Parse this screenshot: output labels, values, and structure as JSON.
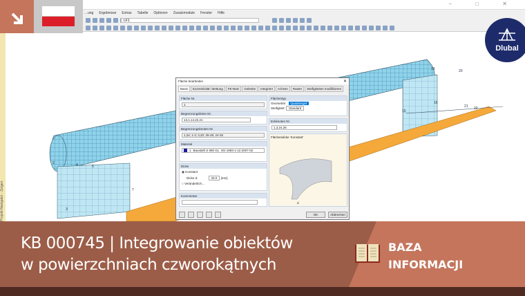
{
  "window": {
    "controls": "–  □  ✕"
  },
  "menu": [
    "…ung",
    "Ergebnisse",
    "Extras",
    "Tabelle",
    "Optionen",
    "Zusatzmodule",
    "Fenster",
    "Hilfe"
  ],
  "toolbar": {
    "loadcase": "LF1"
  },
  "side_panel": "Projekt-Navigator - Zeigen",
  "logo": {
    "text": "Dlubal"
  },
  "model_labels": [
    "19",
    "20",
    "15",
    "16",
    "21",
    "22",
    "2",
    "4",
    "5",
    "7",
    "3"
  ],
  "dialog": {
    "title": "Fläche bearbeiten",
    "tabs": [
      "Basis",
      "Exzentrizität / Bettung",
      "FE-Netz",
      "Gelenke",
      "Integriert",
      "Achsen",
      "Raster",
      "Steifigkeiten modifizieren"
    ],
    "surface_no_label": "Fläche Nr.",
    "surface_no": "1",
    "boundary_lines_label": "Begrenzungslinien Nr.",
    "boundary_lines": "13,1,14,22,21",
    "boundary_nodes_label": "Begrenzungsknoten Nr.",
    "boundary_nodes": "1,24; 1-3; 3,20; 26-28; 24-26",
    "material_label": "Material",
    "material_no": "1",
    "material_name": "Baustahl S 690 GL",
    "material_norm": "EN 1993-1-12:2007-02",
    "thickness_label": "Dicke",
    "constant": "Konstant",
    "thickness_d_label": "Dicke d:",
    "thickness_d": "40.0",
    "unit": "[mm]",
    "variable": "Veränderlich…",
    "comment_label": "Kommentar",
    "surface_type_label": "Flächentyp",
    "geometry_label": "Geometrie:",
    "geometry": "Quadrangel",
    "stiffness_label": "Steifigkeit:",
    "stiffness": "Standard",
    "corner_nodes_label": "Eckknoten Nr.",
    "corner_nodes": "1,3,24,26",
    "preview_label": "Flächendicke 'Konstant'",
    "preview_d": "d",
    "ok": "OK",
    "cancel": "Abbrechen"
  },
  "banner": {
    "title_line1": "KB 000745 | Integrowanie obiektów",
    "title_line2": "w powierzchniach czworokątnych",
    "category_line1": "BAZA",
    "category_line2": "INFORMACJI"
  },
  "colors": {
    "banner": "#9c5d48",
    "banner_light": "#c4755c",
    "banner_dark": "#4e2a20",
    "logo": "#1e2b6b",
    "flag_red": "#dc1e28"
  }
}
